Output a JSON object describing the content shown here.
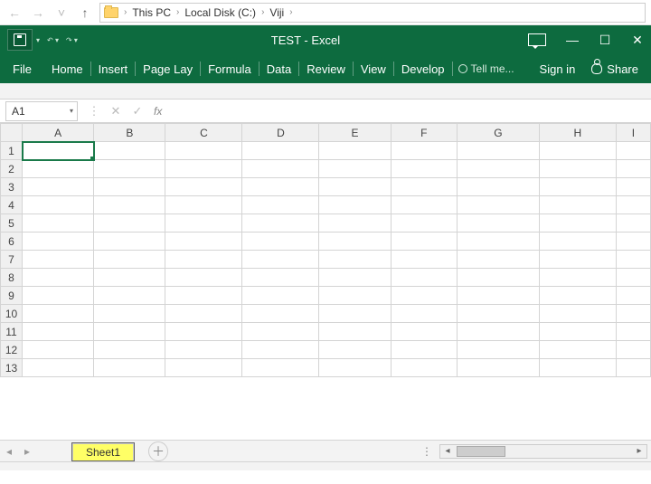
{
  "explorer": {
    "crumbs": [
      "This PC",
      "Local Disk (C:)",
      "Viji"
    ]
  },
  "titlebar": {
    "title": "TEST - Excel"
  },
  "ribbon": {
    "file": "File",
    "tabs": [
      "Home",
      "Insert",
      "Page Lay",
      "Formula",
      "Data",
      "Review",
      "View",
      "Develop"
    ],
    "tell_me": "Tell me...",
    "sign_in": "Sign in",
    "share": "Share"
  },
  "name_box": {
    "value": "A1"
  },
  "fx_label": "fx",
  "grid": {
    "columns": [
      "A",
      "B",
      "C",
      "D",
      "E",
      "F",
      "G",
      "H",
      "I"
    ],
    "rows": [
      1,
      2,
      3,
      4,
      5,
      6,
      7,
      8,
      9,
      10,
      11,
      12,
      13
    ],
    "selected": "A1"
  },
  "sheet_bar": {
    "active_sheet": "Sheet1"
  }
}
